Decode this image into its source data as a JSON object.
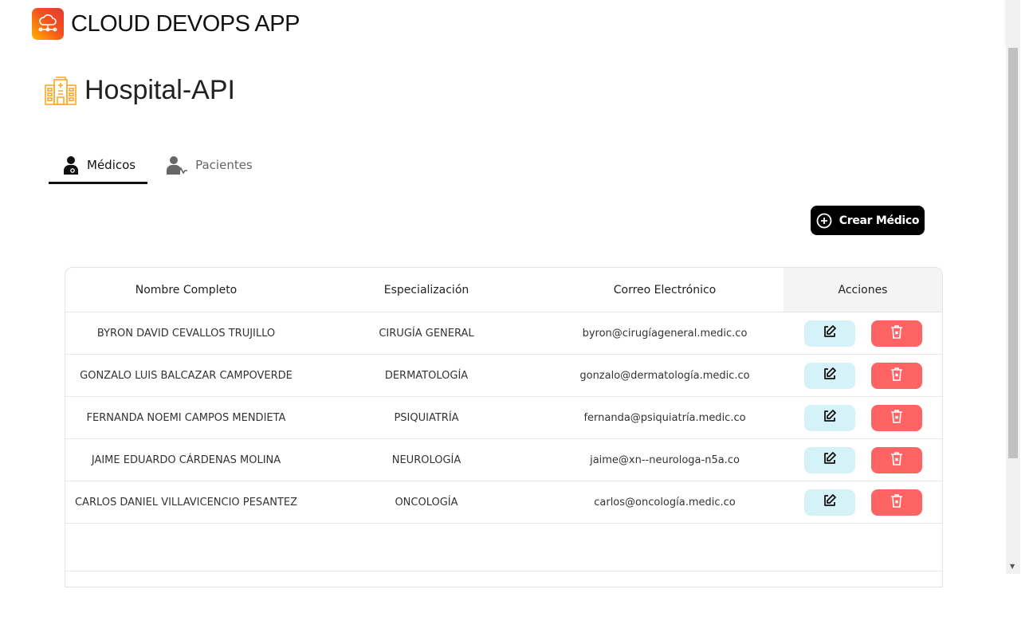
{
  "app": {
    "title": "CLOUD DEVOPS APP",
    "logo_icon": "cloud-network-icon"
  },
  "page": {
    "title": "Hospital-API",
    "icon": "hospital-icon",
    "icon_color": "#ffa726"
  },
  "tabs": [
    {
      "label": "Médicos",
      "icon": "doctor-icon",
      "active": true
    },
    {
      "label": "Pacientes",
      "icon": "patient-icon",
      "active": false
    }
  ],
  "actions": {
    "create_label": "Crear Médico",
    "create_icon": "plus-circle-icon"
  },
  "table": {
    "headers": [
      "Nombre Completo",
      "Especialización",
      "Correo Electrónico",
      "Acciones"
    ],
    "rows": [
      {
        "name": "BYRON DAVID CEVALLOS TRUJILLO",
        "specialty": "CIRUGÍA GENERAL",
        "email": "byron@cirugíageneral.medic.co"
      },
      {
        "name": "GONZALO LUIS BALCAZAR CAMPOVERDE",
        "specialty": "DERMATOLOGÍA",
        "email": "gonzalo@dermatología.medic.co"
      },
      {
        "name": "FERNANDA NOEMI CAMPOS MENDIETA",
        "specialty": "PSIQUIATRÍA",
        "email": "fernanda@psiquiatría.medic.co"
      },
      {
        "name": "JAIME EDUARDO CÁRDENAS MOLINA",
        "specialty": "NEUROLOGÍA",
        "email": "jaime@xn--neurologa-n5a.co"
      },
      {
        "name": "CARLOS DANIEL VILLAVICENCIO PESANTEZ",
        "specialty": "ONCOLOGÍA",
        "email": "carlos@oncología.medic.co"
      }
    ],
    "edit_color": "#d6f2f9",
    "delete_color": "#fe6464"
  }
}
